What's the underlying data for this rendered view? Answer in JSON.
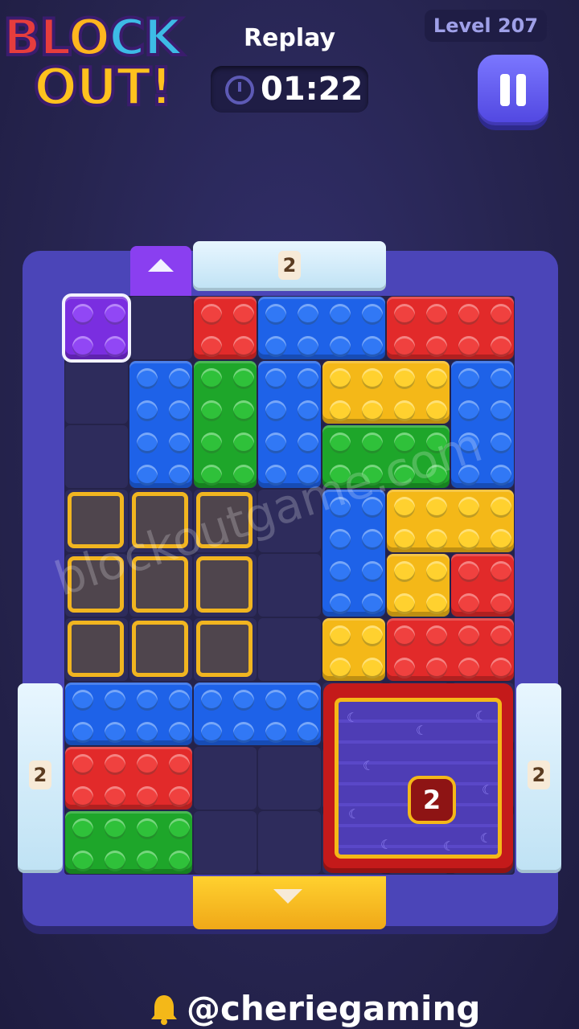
{
  "header": {
    "logo_line1_a": "BL",
    "logo_line1_b": "O",
    "logo_line1_c": "CK",
    "logo_line2": "OUT!",
    "mode_label": "Replay",
    "timer": "01:22",
    "level_label": "Level 207"
  },
  "board": {
    "gate_top_count": "2",
    "gate_left_count": "2",
    "gate_right_count": "2",
    "box_count": "2"
  },
  "watermark": "blockoutgame.com",
  "footer": {
    "handle": "@cheriegaming"
  },
  "colors": {
    "red": "#e22a2a",
    "blue": "#1e62e8",
    "green": "#1ea62a",
    "yellow": "#f4b818",
    "purple": "#7a2ee0",
    "frame": "#4b45b8"
  },
  "icons": [
    "clock-icon",
    "pause-icon",
    "up-arrow-icon",
    "down-arrow-icon",
    "bell-icon",
    "moon-icon"
  ]
}
